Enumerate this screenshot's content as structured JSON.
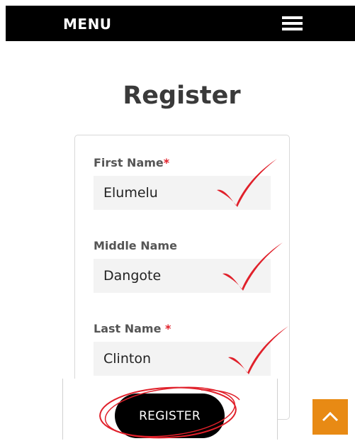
{
  "header": {
    "menu_label": "MENU",
    "hamburger_icon": "hamburger-menu-icon"
  },
  "page": {
    "title": "Register"
  },
  "form": {
    "fields": [
      {
        "label": "First Name",
        "required_mark": "*",
        "value": "Elumelu"
      },
      {
        "label": "Middle Name",
        "required_mark": "",
        "value": "Dangote"
      },
      {
        "label": "Last Name ",
        "required_mark": "*",
        "value": "Clinton"
      }
    ],
    "submit_label": "REGISTER"
  },
  "annotations": {
    "check_icon": "red-checkmark-icon",
    "circle_color": "#e0202a"
  },
  "scroll_top": {
    "icon": "chevron-up-icon",
    "color": "#e88a14"
  },
  "colors": {
    "header_bg": "#000000",
    "required": "#e0202a",
    "input_bg": "#f3f3f3"
  }
}
